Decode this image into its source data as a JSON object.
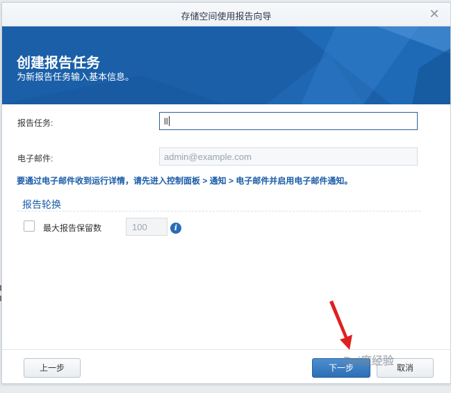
{
  "window": {
    "title": "存储空间使用报告向导",
    "close_icon": "close-icon"
  },
  "banner": {
    "heading": "创建报告任务",
    "subheading": "为新报告任务输入基本信息。",
    "color": "#1a5fa8"
  },
  "form": {
    "task_label": "报告任务:",
    "task_value": "ll",
    "email_label": "电子邮件:",
    "email_placeholder": "admin@example.com",
    "notice": "要通过电子邮件收到运行详情，请先进入控制面板 > 通知 > 电子邮件并启用电子邮件通知。"
  },
  "rotation": {
    "section_title": "报告轮换",
    "max_label": "最大报告保留数",
    "max_value": "100",
    "checked": false,
    "info_icon": "info-icon"
  },
  "footer": {
    "prev_label": "上一步",
    "next_label": "下一步",
    "cancel_label": "取消"
  },
  "accent_color": "#2a6db5",
  "annotation": {
    "arrow_color": "#e02020",
    "watermark": "Bai度经验"
  }
}
